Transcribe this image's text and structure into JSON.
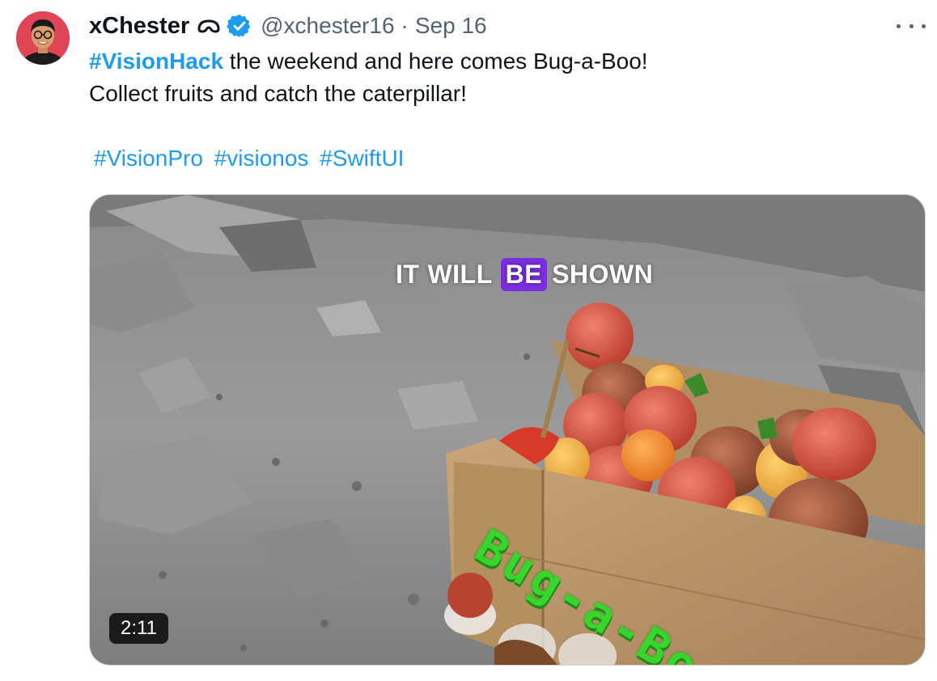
{
  "author": {
    "display_name": "xChester",
    "handle": "@xchester16",
    "separator": "·",
    "date": "Sep 16",
    "avatar_icon": "person-avatar-icon",
    "name_glyph_icon": "vision-pro-glyph-icon",
    "verified_icon": "verified-badge-icon"
  },
  "more_icon": "more-horizontal-icon",
  "tweet": {
    "line1_hashtag": "#VisionHack",
    "line1_text": " the weekend and here comes Bug-a-Boo!",
    "line2_text": "Collect fruits and catch the caterpillar!",
    "hashtags": [
      "#VisionPro",
      "#visionos",
      "#SwiftUI"
    ]
  },
  "video": {
    "caption_words": [
      "IT",
      "WILL",
      "BE",
      "SHOWN"
    ],
    "caption_highlight_color": "#7a2ee0",
    "duration": "2:11",
    "crate_title": "Bug-a-Boo"
  },
  "colors": {
    "link": "#1d9bf0",
    "secondary_text": "#536471",
    "verified": "#1d9bf0"
  }
}
